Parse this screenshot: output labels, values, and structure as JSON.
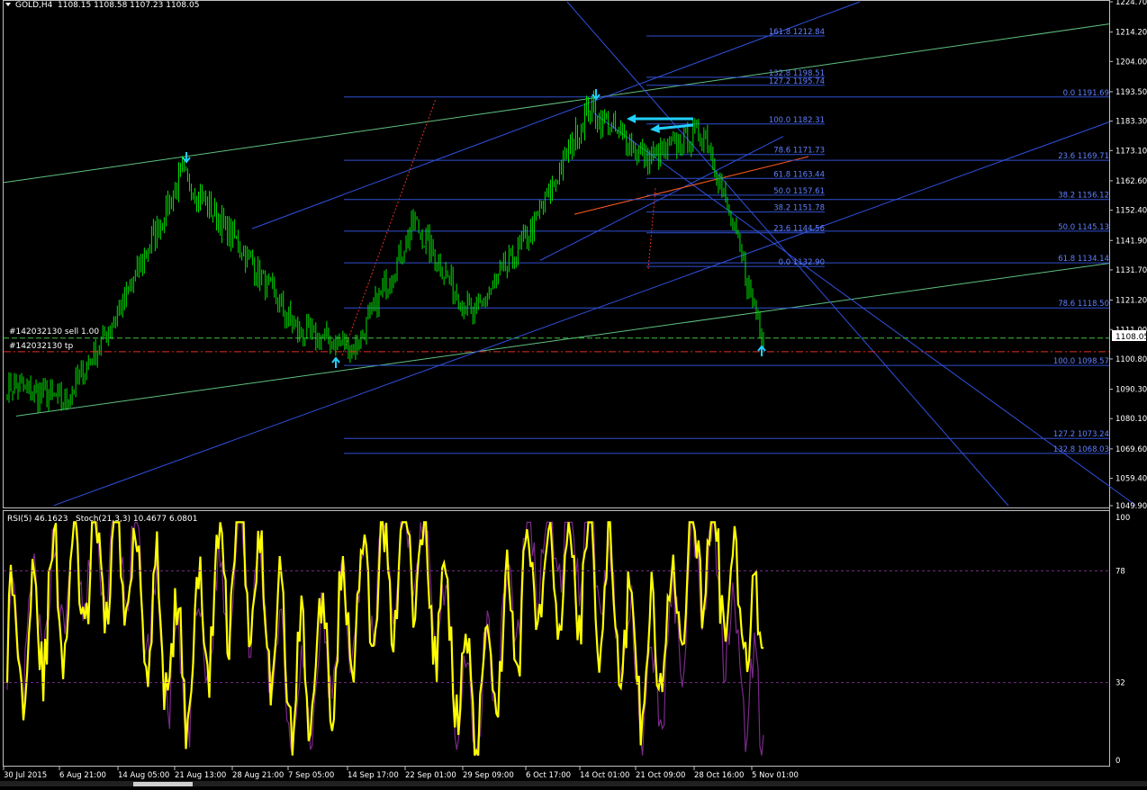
{
  "header": {
    "symbol": "GOLD,H4",
    "ohlc": "1108.15 1108.58 1107.23 1108.05",
    "rsi_label": "RSI(5) 46.1623",
    "stoch_label": "Stoch(21,3,3) 10.4677 6.0801"
  },
  "colors": {
    "background": "#000000",
    "candles": "#00e000",
    "channel_green": "#60c080",
    "channel_blue": "#3050e0",
    "fib_line": "#3050d0",
    "fib_text": "#6080ff",
    "orange_line": "#ff5a20",
    "red_dotted": "#e03020",
    "arrow_cyan": "#22d0ff",
    "rsi": "#ffff00",
    "stoch": "#7a2a8a",
    "axis_text": "#ffffff",
    "sell_line": "#40c040",
    "tp_line": "#e03020"
  },
  "trade": {
    "sell_label": "#142032130 sell 1.00",
    "tp_label": "#142032130 tp",
    "current_price_tag": "1108.05",
    "sell_price": 1108.05,
    "tp_price": 1103.3
  },
  "chart_data": [
    {
      "type": "line",
      "title": "GOLD,H4",
      "series": [
        {
          "name": "GOLD,H4",
          "x": [
            "30 Jul 2015",
            "6 Aug 21:00",
            "14 Aug 05:00",
            "21 Aug 13:00",
            "28 Aug 21:00",
            "7 Sep 05:00",
            "14 Sep 17:00",
            "22 Sep 01:00",
            "29 Sep 09:00",
            "6 Oct 17:00",
            "14 Oct 01:00",
            "21 Oct 09:00",
            "28 Oct 16:00",
            "5 Nov 01:00"
          ],
          "y": [
            1092.0,
            1086.0,
            1120.0,
            1165.0,
            1140.0,
            1110.0,
            1105.0,
            1148.0,
            1115.0,
            1145.0,
            1188.0,
            1170.0,
            1180.0,
            1108.05
          ]
        }
      ],
      "ylim": [
        1049.9,
        1224.7
      ],
      "y_ticks": [
        "1224.70",
        "1214.20",
        "1204.00",
        "1193.50",
        "1183.30",
        "1173.10",
        "1162.60",
        "1152.40",
        "1141.90",
        "1131.70",
        "1121.20",
        "1111.00",
        "1100.80",
        "1090.30",
        "1080.10",
        "1069.60",
        "1059.40",
        "1049.90"
      ],
      "x_ticks": [
        "30 Jul 2015",
        "6 Aug 21:00",
        "14 Aug 05:00",
        "21 Aug 13:00",
        "28 Aug 21:00",
        "7 Sep 05:00",
        "14 Sep 17:00",
        "22 Sep 01:00",
        "29 Sep 09:00",
        "6 Oct 17:00",
        "14 Oct 01:00",
        "21 Oct 09:00",
        "28 Oct 16:00",
        "5 Nov 01:00"
      ],
      "grid": false,
      "fib_levels_right": [
        "0.0 1191.69",
        "23.6 1169.71",
        "38.2 1156.12",
        "50.0 1145.13",
        "61.8 1134.14",
        "78.6 1118.50",
        "100.0 1098.57",
        "127.2 1073.24",
        "132.8 1068.03"
      ],
      "fib_levels_mid": [
        "161.8 1212.84",
        "132.8 1198.51",
        "127.2 1195.74",
        "100.0 1182.31",
        "78.6 1171.73",
        "61.8 1163.44",
        "50.0 1157.61",
        "38.2 1151.78",
        "23.6 1144.56",
        "0.0 1132.90"
      ]
    },
    {
      "type": "line",
      "title": "RSI(5) 46.1623 Stoch(21,3,3) 10.4677 6.0801",
      "series": [
        {
          "name": "RSI(5)",
          "x": [
            "30 Jul 2015",
            "6 Aug 21:00",
            "14 Aug 05:00",
            "21 Aug 13:00",
            "28 Aug 21:00",
            "7 Sep 05:00",
            "14 Sep 17:00",
            "22 Sep 01:00",
            "29 Sep 09:00",
            "6 Oct 17:00",
            "14 Oct 01:00",
            "21 Oct 09:00",
            "28 Oct 16:00",
            "5 Nov 01:00"
          ],
          "y": [
            45,
            70,
            85,
            35,
            90,
            30,
            60,
            88,
            25,
            75,
            82,
            35,
            92,
            46.16
          ]
        },
        {
          "name": "Stoch(21,3,3)",
          "x": [
            "30 Jul 2015",
            "6 Aug 21:00",
            "14 Aug 05:00",
            "21 Aug 13:00",
            "28 Aug 21:00",
            "7 Sep 05:00",
            "14 Sep 17:00",
            "22 Sep 01:00",
            "29 Sep 09:00",
            "6 Oct 17:00",
            "14 Oct 01:00",
            "21 Oct 09:00",
            "28 Oct 16:00",
            "5 Nov 01:00"
          ],
          "y": [
            40,
            75,
            90,
            25,
            85,
            20,
            65,
            92,
            15,
            90,
            95,
            20,
            88,
            10.47
          ]
        }
      ],
      "ylim": [
        0,
        100
      ],
      "y_ticks": [
        "100",
        "78",
        "32",
        "0"
      ],
      "levels": [
        78,
        32
      ],
      "grid": false
    }
  ]
}
